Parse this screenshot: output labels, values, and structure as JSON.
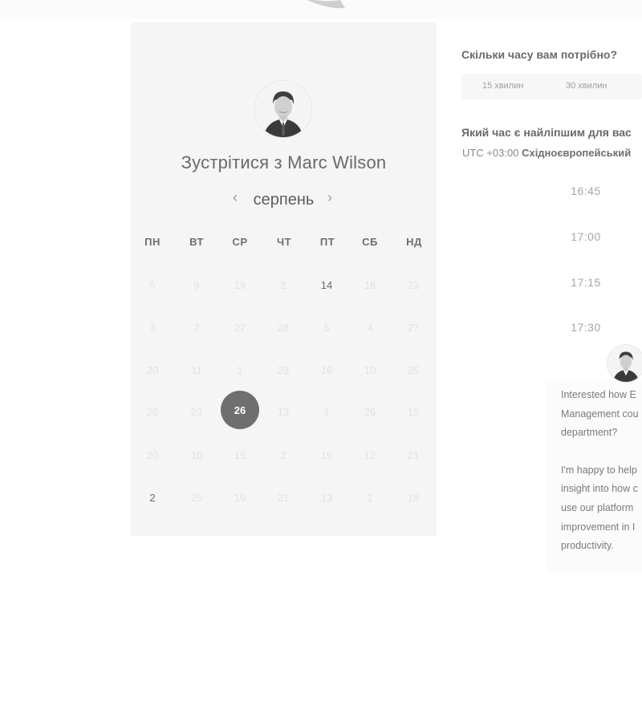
{
  "calendar": {
    "title": "Зустрітися з Marc Wilson",
    "month": "серпень",
    "prev_icon": "chevron-left-icon",
    "next_icon": "chevron-right-icon",
    "weekdays": [
      "ПН",
      "ВТ",
      "СР",
      "ЧТ",
      "ПТ",
      "СБ",
      "НД"
    ],
    "weeks": [
      [
        "5",
        "9",
        "19",
        "2",
        "14",
        "18",
        "23"
      ],
      [
        "3",
        "7",
        "27",
        "28",
        "5",
        "4",
        "27"
      ],
      [
        "20",
        "11",
        "1",
        "23",
        "16",
        "10",
        "25"
      ],
      [
        "26",
        "23",
        "26",
        "13",
        "1",
        "26",
        "15"
      ],
      [
        "20",
        "10",
        "15",
        "2",
        "19",
        "12",
        "21"
      ],
      [
        "2",
        "25",
        "19",
        "21",
        "13",
        "1",
        "18"
      ]
    ],
    "available": [
      [
        0,
        4
      ],
      [
        5,
        0
      ]
    ],
    "selected": [
      3,
      2
    ]
  },
  "duration": {
    "question": "Скільки часу вам потрібно?",
    "options": [
      "15 хвилин",
      "30 хвилин"
    ]
  },
  "time": {
    "question": "Який час є найліпшим для вас",
    "tz_offset": "UTC +03:00",
    "tz_name": "Східноєвропейський",
    "slots": [
      "16:45",
      "17:00",
      "17:15",
      "17:30"
    ]
  },
  "chat": {
    "lines": [
      "Interested how E",
      "Management cou",
      "department?",
      "",
      "I'm happy to help",
      "insight into how c",
      "use our platform",
      "improvement in I",
      "productivity."
    ]
  }
}
